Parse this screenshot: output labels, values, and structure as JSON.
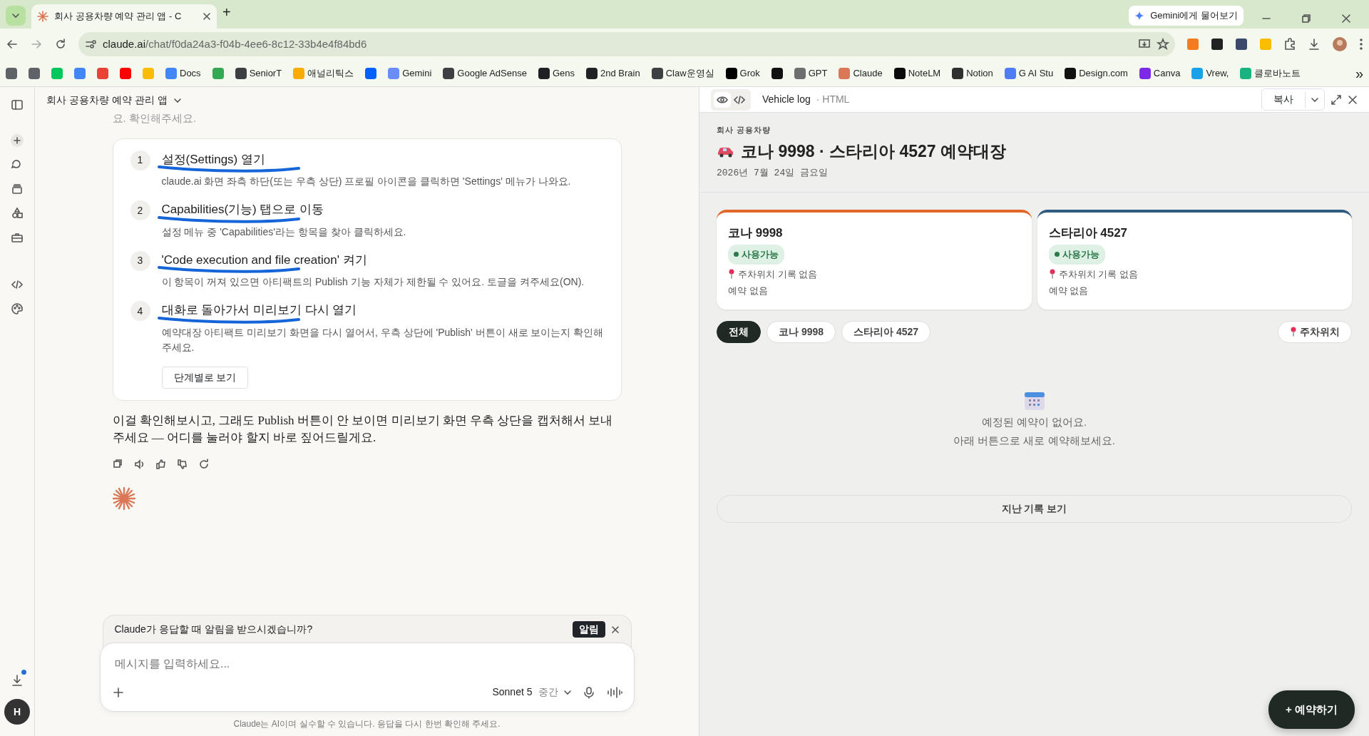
{
  "browser": {
    "tabs": [
      {
        "title": "회사 공용차량 예약 관리 앱 - C",
        "selected": true
      }
    ],
    "new_tab": "+",
    "gemini_button": "Gemini에게 물어보기",
    "url": {
      "host": "claude.ai",
      "path": "/chat/f0da24a3-f04b-4ee6-8c12-33b4e4f84bd6"
    },
    "bookmarks": [
      {
        "color": "#5f6368"
      },
      {
        "color": "#5f6368"
      },
      {
        "color": "#03c75a"
      },
      {
        "color": "#4285f4"
      },
      {
        "color": "#ea4335"
      },
      {
        "color": "#ff0000"
      },
      {
        "color": "#fbbc04"
      },
      {
        "label": "Docs",
        "color": "#4285f4"
      },
      {
        "color": "#34a853"
      },
      {
        "label": "SeniorT",
        "color": "#3c4043"
      },
      {
        "label": "애널리틱스",
        "color": "#f9ab00"
      },
      {
        "color": "#0061fe"
      },
      {
        "label": "Gemini",
        "color": "#6b8cf5"
      },
      {
        "label": "Google AdSense",
        "color": "#3c4043"
      },
      {
        "label": "Gens",
        "color": "#202124"
      },
      {
        "label": "2nd Brain",
        "color": "#202124"
      },
      {
        "label": "Claw운영실",
        "color": "#3c4043"
      },
      {
        "label": "Grok",
        "color": "#000000"
      },
      {
        "color": "#111111"
      },
      {
        "label": "GPT",
        "color": "#6e6e6e"
      },
      {
        "label": "Claude",
        "color": "#d97757"
      },
      {
        "label": "NoteLM",
        "color": "#0a0a0a"
      },
      {
        "label": "Notion",
        "color": "#2f2f2f"
      },
      {
        "label": "G AI Stu",
        "color": "#4f7df3"
      },
      {
        "label": "Design.com",
        "color": "#111111"
      },
      {
        "label": "Canva",
        "color": "#7d2ae8"
      },
      {
        "label": "Vrew,",
        "color": "#1aa1e8"
      },
      {
        "label": "클로바노트",
        "color": "#18b37e"
      }
    ],
    "bookmarks_overflow": "»"
  },
  "chat": {
    "title": "회사 공용차량 예약 관리 앱",
    "faded_text": "요. 확인해주세요.",
    "steps": [
      {
        "number": "1",
        "title": "설정(Settings) 열기",
        "description": "claude.ai 화면 좌측 하단(또는 우측 상단) 프로필 아이콘을 클릭하면 'Settings' 메뉴가 나와요.",
        "marked": true
      },
      {
        "number": "2",
        "title": "Capabilities(기능) 탭으로 이동",
        "description": "설정 메뉴 중 'Capabilities'라는 항목을 찾아 클릭하세요.",
        "marked": true
      },
      {
        "number": "3",
        "title": "'Code execution and file creation' 켜기",
        "description": "이 항목이 꺼져 있으면 아티팩트의 Publish 기능 자체가 제한될 수 있어요. 토글을 켜주세요(ON).",
        "marked": true
      },
      {
        "number": "4",
        "title": "대화로 돌아가서 미리보기 다시 열기",
        "description": "예약대장 아티팩트 미리보기 화면을 다시 열어서, 우측 상단에 'Publish' 버튼이 새로 보이는지 확인해 주세요.",
        "marked": true
      }
    ],
    "steps_button": "단계별로 보기",
    "reply": "이걸 확인해보시고, 그래도 Publish 버튼이 안 보이면 미리보기 화면 우측 상단을 캡처해서 보내주세요 — 어디를 눌러야 할지 바로 짚어드릴게요.",
    "notification": {
      "text": "Claude가 응답할 때 알림을 받으시겠습니까?",
      "button": "알림"
    },
    "composer": {
      "placeholder": "메시지를 입력하세요...",
      "model": "Sonnet 5",
      "effort": "중간"
    },
    "footer": "Claude는 AI이며 실수할 수 있습니다. 응답을 다시 한번 확인해 주세요.",
    "avatar": "H",
    "downloads_badge": true
  },
  "artifact": {
    "view_modes": [
      {
        "kind": "preview",
        "selected": true
      },
      {
        "kind": "code",
        "selected": false
      }
    ],
    "title": "Vehicle log",
    "subtitle": "· HTML",
    "copy_button": "복사",
    "app": {
      "eyebrow": "회사 공용차량",
      "title": "코나 9998 · 스타리아 4527 예약대장",
      "date": "2026년 7월 24일 금요일",
      "vehicles": [
        {
          "name": "코나 9998",
          "color": "#e0682b",
          "status": "사용가능",
          "parking": "주차위치 기록 없음",
          "reservations": "예약 없음"
        },
        {
          "name": "스타리아 4527",
          "color": "#2f5b80",
          "status": "사용가능",
          "parking": "주차위치 기록 없음",
          "reservations": "예약 없음"
        }
      ],
      "filters": [
        {
          "label": "전체",
          "selected": true
        },
        {
          "label": "코나 9998",
          "selected": false
        },
        {
          "label": "스타리아 4527",
          "selected": false
        }
      ],
      "parking_button": "주차위치",
      "empty_lines": [
        "예정된 예약이 없어요.",
        "아래 버튼으로 새로 예약해보세요."
      ],
      "history_button": "지난 기록 보기",
      "fab": "+ 예약하기"
    }
  }
}
